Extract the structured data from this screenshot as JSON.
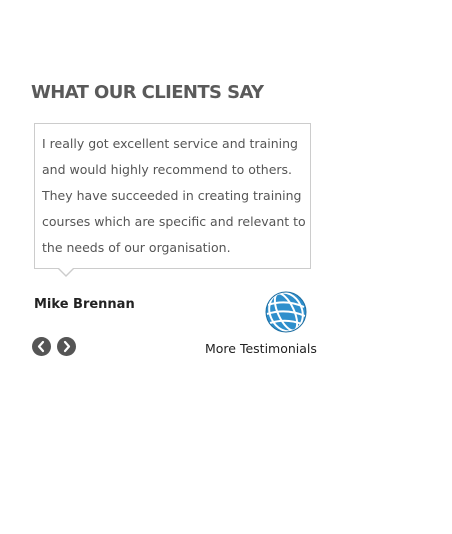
{
  "testimonials": {
    "title": "WHAT OUR CLIENTS SAY",
    "quote": "I really got excellent service and training and would highly recommend to others. They have succeeded in creating training courses which are specific and relevant to the needs of our organisation.",
    "author": "Mike Brennan",
    "more_link": "More Testimonials",
    "icons": {
      "globe": "globe-icon",
      "prev": "chevron-left-icon",
      "next": "chevron-right-icon"
    },
    "colors": {
      "title": "#5a5a5a",
      "globe": "#2f8fcc",
      "nav_button": "#555555",
      "border": "#cccccc"
    }
  }
}
